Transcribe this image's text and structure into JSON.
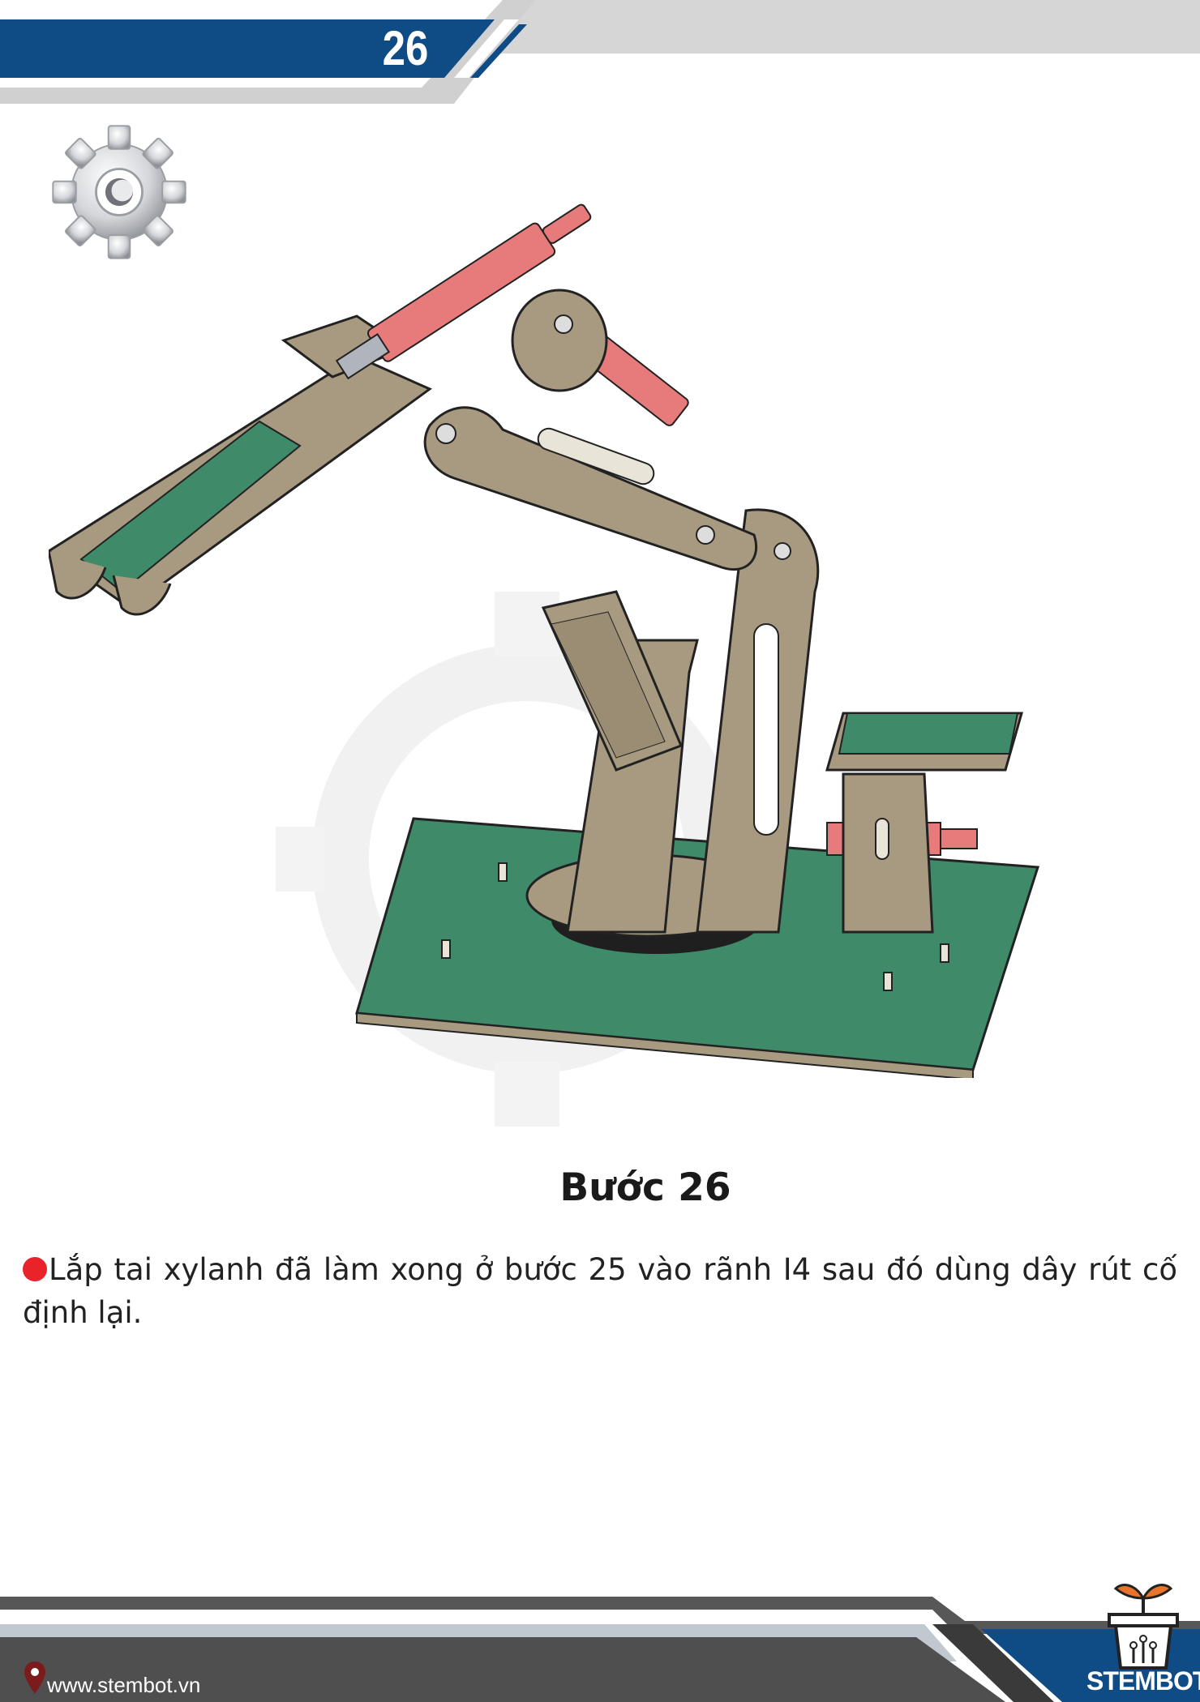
{
  "header": {
    "page_number": "26"
  },
  "step": {
    "title": "Bước 26",
    "instruction": "Lắp tai xylanh đã làm xong ở bước 25 vào rãnh I4 sau đó dùng dây rút cố định lại."
  },
  "footer": {
    "website": "www.stembot.vn",
    "brand": "STEMBOT"
  },
  "colors": {
    "header_blue": "#0f4c86",
    "header_gray": "#d6d6d6",
    "bullet_red": "#e8232a",
    "board_green": "#3f8a68",
    "wood": "#a89a80",
    "cylinder_red": "#e77a7a"
  },
  "icons": [
    "gear-icon",
    "location-pin-icon",
    "stembot-logo-icon"
  ]
}
